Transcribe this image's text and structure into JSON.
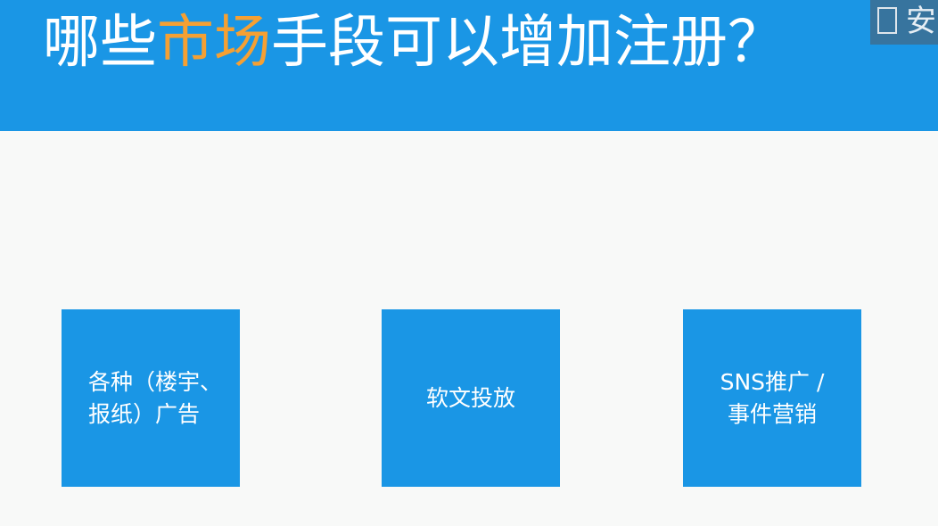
{
  "title": {
    "prefix": "哪些",
    "highlight": "市场",
    "suffix": "手段可以增加注册？",
    "highlight_color": "#f5a033"
  },
  "corner_overlay": {
    "text": "安"
  },
  "cards": [
    {
      "label": "各种（楼宇、\n报纸）广告"
    },
    {
      "label": "软文投放"
    },
    {
      "label": "SNS推广 /\n事件营销"
    }
  ],
  "colors": {
    "accent": "#1a96e5",
    "background": "#f8f9f8",
    "text_on_accent": "#ffffff"
  }
}
